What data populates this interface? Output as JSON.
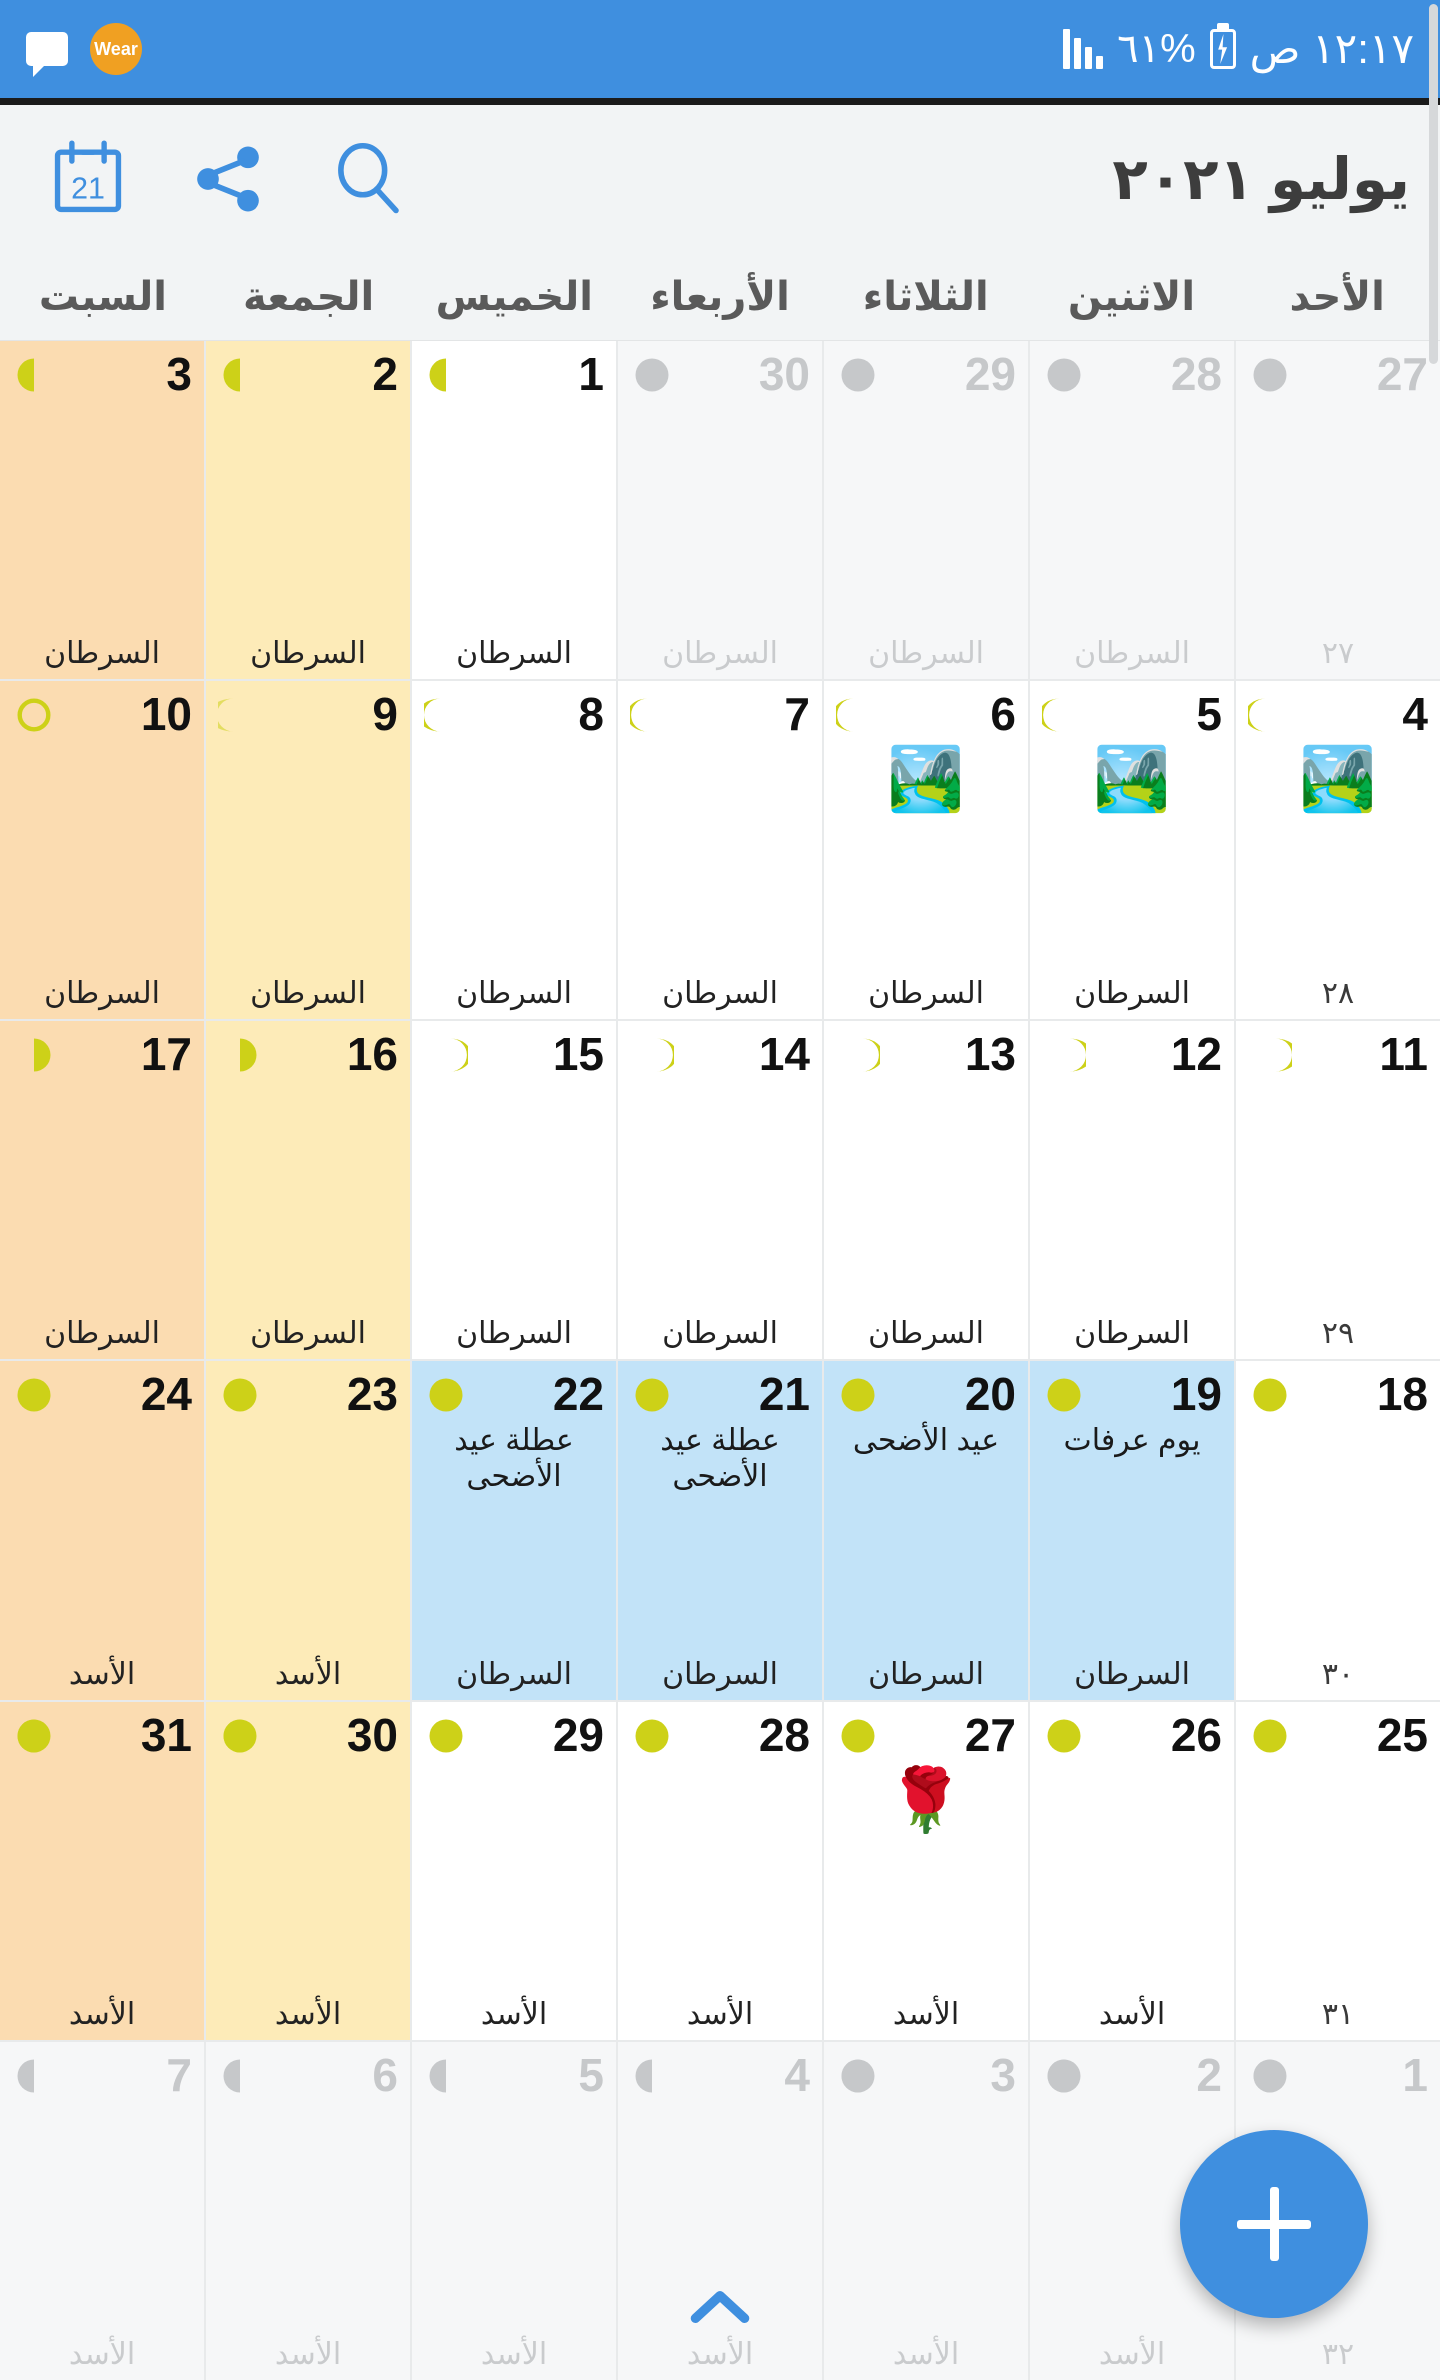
{
  "status_bar": {
    "time": "١٢:١٧ ص",
    "battery_percent": "%٦١",
    "battery_icon": "battery-charging-icon",
    "signal_icon": "signal-bars-icon",
    "chat_icon": "chat-bubble-icon",
    "wear_label": "Wear",
    "background_color": "#3f8fdf"
  },
  "toolbar": {
    "month_title": "يوليو ٢٠٢١",
    "search_icon": "search-icon",
    "share_icon": "share-icon",
    "today_icon": "calendar-today-icon",
    "today_badge": "21",
    "accent_color": "#3f8fdf"
  },
  "weekdays": [
    {
      "label": "الأحد"
    },
    {
      "label": "الاثنين"
    },
    {
      "label": "الثلاثاء"
    },
    {
      "label": "الأربعاء"
    },
    {
      "label": "الخميس"
    },
    {
      "label": "الجمعة"
    },
    {
      "label": "السبت"
    }
  ],
  "legend_colors": {
    "saturday_bg": "#fbdcb1",
    "friday_bg": "#fdebb8",
    "holiday_bg": "#c2e3f8",
    "muted_bg": "#f6f7f8",
    "moon_yellow": "#cdd118",
    "moon_gray": "#c6c8ca"
  },
  "weeks": [
    {
      "days": [
        {
          "num": "27",
          "zodiac": "٢٧",
          "event": "",
          "emoji": "",
          "moon": "gibbous",
          "style": "muted",
          "hijri_bottom": true
        },
        {
          "num": "28",
          "zodiac": "السرطان",
          "event": "",
          "emoji": "",
          "moon": "gibbous",
          "style": "muted",
          "hijri_bottom": false
        },
        {
          "num": "29",
          "zodiac": "السرطان",
          "event": "",
          "emoji": "",
          "moon": "gibbous",
          "style": "muted",
          "hijri_bottom": false
        },
        {
          "num": "30",
          "zodiac": "السرطان",
          "event": "",
          "emoji": "",
          "moon": "gibbous",
          "style": "muted",
          "hijri_bottom": false
        },
        {
          "num": "1",
          "zodiac": "السرطان",
          "event": "",
          "emoji": "",
          "moon": "last-quarter",
          "style": "normal",
          "hijri_bottom": false
        },
        {
          "num": "2",
          "zodiac": "السرطان",
          "event": "",
          "emoji": "",
          "moon": "last-quarter",
          "style": "friday",
          "hijri_bottom": false
        },
        {
          "num": "3",
          "zodiac": "السرطان",
          "event": "",
          "emoji": "",
          "moon": "last-quarter",
          "style": "saturday",
          "hijri_bottom": false
        }
      ]
    },
    {
      "days": [
        {
          "num": "4",
          "zodiac": "٢٨",
          "event": "",
          "emoji": "🏞️",
          "moon": "waning-crescent",
          "style": "normal",
          "hijri_bottom": true
        },
        {
          "num": "5",
          "zodiac": "السرطان",
          "event": "",
          "emoji": "🏞️",
          "moon": "waning-crescent",
          "style": "normal",
          "hijri_bottom": false
        },
        {
          "num": "6",
          "zodiac": "السرطان",
          "event": "",
          "emoji": "🏞️",
          "moon": "waning-crescent",
          "style": "normal",
          "hijri_bottom": false
        },
        {
          "num": "7",
          "zodiac": "السرطان",
          "event": "",
          "emoji": "",
          "moon": "waning-crescent",
          "style": "normal",
          "hijri_bottom": false
        },
        {
          "num": "8",
          "zodiac": "السرطان",
          "event": "",
          "emoji": "",
          "moon": "waning-crescent-thin",
          "style": "normal",
          "hijri_bottom": false
        },
        {
          "num": "9",
          "zodiac": "السرطان",
          "event": "",
          "emoji": "",
          "moon": "new",
          "style": "friday",
          "hijri_bottom": false
        },
        {
          "num": "10",
          "zodiac": "السرطان",
          "event": "",
          "emoji": "",
          "moon": "new-ring",
          "style": "saturday",
          "hijri_bottom": false
        }
      ]
    },
    {
      "days": [
        {
          "num": "11",
          "zodiac": "٢٩",
          "event": "",
          "emoji": "",
          "moon": "waxing-crescent-thin",
          "style": "normal",
          "hijri_bottom": true
        },
        {
          "num": "12",
          "zodiac": "السرطان",
          "event": "",
          "emoji": "",
          "moon": "waxing-crescent-thin",
          "style": "normal",
          "hijri_bottom": false
        },
        {
          "num": "13",
          "zodiac": "السرطان",
          "event": "",
          "emoji": "",
          "moon": "waxing-crescent",
          "style": "normal",
          "hijri_bottom": false
        },
        {
          "num": "14",
          "zodiac": "السرطان",
          "event": "",
          "emoji": "",
          "moon": "waxing-crescent",
          "style": "normal",
          "hijri_bottom": false
        },
        {
          "num": "15",
          "zodiac": "السرطان",
          "event": "",
          "emoji": "",
          "moon": "waxing-crescent",
          "style": "normal",
          "hijri_bottom": false
        },
        {
          "num": "16",
          "zodiac": "السرطان",
          "event": "",
          "emoji": "",
          "moon": "first-quarter",
          "style": "friday",
          "hijri_bottom": false
        },
        {
          "num": "17",
          "zodiac": "السرطان",
          "event": "",
          "emoji": "",
          "moon": "first-quarter",
          "style": "saturday",
          "hijri_bottom": false
        }
      ]
    },
    {
      "days": [
        {
          "num": "18",
          "zodiac": "٣٠",
          "event": "",
          "emoji": "",
          "moon": "waxing-gibbous",
          "style": "normal",
          "hijri_bottom": true
        },
        {
          "num": "19",
          "zodiac": "السرطان",
          "event": "يوم عرفات",
          "emoji": "",
          "moon": "full",
          "style": "holiday",
          "hijri_bottom": false
        },
        {
          "num": "20",
          "zodiac": "السرطان",
          "event": "عيد الأضحى",
          "emoji": "",
          "moon": "full",
          "style": "holiday",
          "hijri_bottom": false
        },
        {
          "num": "21",
          "zodiac": "السرطان",
          "event": "عطلة عيد الأضحى",
          "emoji": "",
          "moon": "full",
          "style": "holiday",
          "hijri_bottom": false
        },
        {
          "num": "22",
          "zodiac": "السرطان",
          "event": "عطلة عيد الأضحى",
          "emoji": "",
          "moon": "full",
          "style": "holiday",
          "hijri_bottom": false
        },
        {
          "num": "23",
          "zodiac": "الأسد",
          "event": "",
          "emoji": "",
          "moon": "full",
          "style": "friday",
          "hijri_bottom": false
        },
        {
          "num": "24",
          "zodiac": "الأسد",
          "event": "",
          "emoji": "",
          "moon": "full",
          "style": "saturday",
          "hijri_bottom": false
        }
      ]
    },
    {
      "days": [
        {
          "num": "25",
          "zodiac": "٣١",
          "event": "",
          "emoji": "",
          "moon": "full",
          "style": "normal",
          "hijri_bottom": true
        },
        {
          "num": "26",
          "zodiac": "الأسد",
          "event": "",
          "emoji": "",
          "moon": "full",
          "style": "normal",
          "hijri_bottom": false
        },
        {
          "num": "27",
          "zodiac": "الأسد",
          "event": "",
          "emoji": "🌹",
          "moon": "full",
          "style": "normal",
          "hijri_bottom": false
        },
        {
          "num": "28",
          "zodiac": "الأسد",
          "event": "",
          "emoji": "",
          "moon": "full",
          "style": "normal",
          "hijri_bottom": false
        },
        {
          "num": "29",
          "zodiac": "الأسد",
          "event": "",
          "emoji": "",
          "moon": "full",
          "style": "normal",
          "hijri_bottom": false
        },
        {
          "num": "30",
          "zodiac": "الأسد",
          "event": "",
          "emoji": "",
          "moon": "waning-gibbous",
          "style": "friday",
          "hijri_bottom": false
        },
        {
          "num": "31",
          "zodiac": "الأسد",
          "event": "",
          "emoji": "",
          "moon": "waning-gibbous",
          "style": "saturday",
          "hijri_bottom": false
        }
      ]
    },
    {
      "days": [
        {
          "num": "1",
          "zodiac": "٣٢",
          "event": "",
          "emoji": "",
          "moon": "waning-gibbous",
          "style": "muted",
          "hijri_bottom": true
        },
        {
          "num": "2",
          "zodiac": "الأسد",
          "event": "",
          "emoji": "",
          "moon": "waning-gibbous",
          "style": "muted",
          "hijri_bottom": false
        },
        {
          "num": "3",
          "zodiac": "الأسد",
          "event": "",
          "emoji": "",
          "moon": "waning-gibbous",
          "style": "muted",
          "hijri_bottom": false
        },
        {
          "num": "4",
          "zodiac": "الأسد",
          "event": "",
          "emoji": "",
          "moon": "last-quarter",
          "style": "muted",
          "hijri_bottom": false
        },
        {
          "num": "5",
          "zodiac": "الأسد",
          "event": "",
          "emoji": "",
          "moon": "last-quarter",
          "style": "muted",
          "hijri_bottom": false
        },
        {
          "num": "6",
          "zodiac": "الأسد",
          "event": "",
          "emoji": "",
          "moon": "last-quarter",
          "style": "muted",
          "hijri_bottom": false
        },
        {
          "num": "7",
          "zodiac": "الأسد",
          "event": "",
          "emoji": "",
          "moon": "last-quarter",
          "style": "muted",
          "hijri_bottom": false
        }
      ]
    }
  ],
  "fab": {
    "label": "+",
    "icon": "add-icon",
    "color": "#3f8fdf"
  },
  "expand_hint_icon": "chevron-up-icon",
  "scrollbar": {
    "icon": "vertical-scrollbar"
  }
}
